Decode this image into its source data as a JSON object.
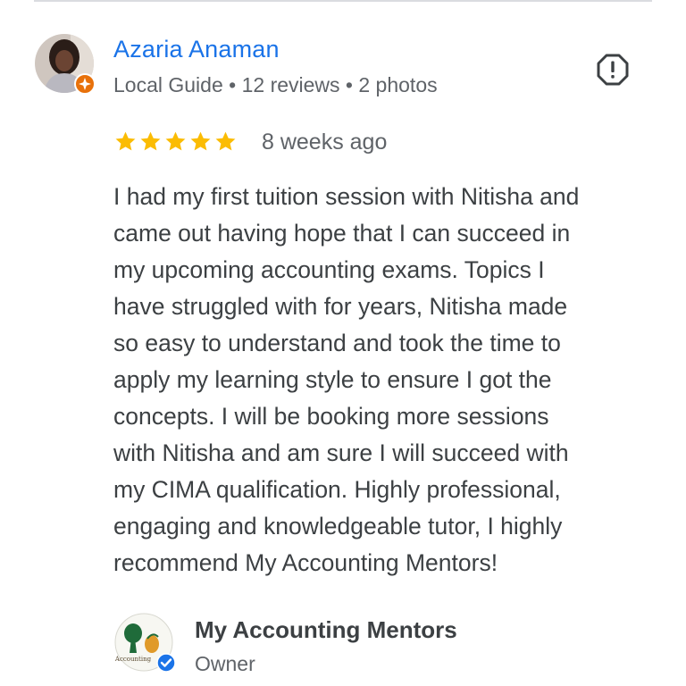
{
  "reviewer": {
    "name": "Azaria Anaman",
    "badge": "Local Guide",
    "reviews": "12 reviews",
    "photos": "2 photos",
    "separator": " • "
  },
  "review": {
    "rating": 5,
    "max_rating": 5,
    "date": "8 weeks ago",
    "text_lines": [
      "I had my first tuition session with Nitisha and",
      "came out having hope that I can succeed in",
      "my upcoming accounting exams. Topics I",
      "have struggled with for years, Nitisha made",
      "so easy to understand and took the time to",
      "apply my learning style to ensure I got the",
      "concepts. I will be booking more sessions",
      "with Nitisha and am sure I will succeed with",
      "my CIMA qualification. Highly professional,",
      "engaging and knowledgeable tutor, I highly",
      "recommend My Accounting Mentors!"
    ]
  },
  "owner": {
    "name": "My Accounting Mentors",
    "role": "Owner",
    "logo_text": "Accounting"
  },
  "icons": {
    "report": "report-icon",
    "star": "star-icon",
    "local_guide": "local-guide-badge-icon",
    "verified": "verified-check-icon"
  },
  "colors": {
    "name_link": "#1a73e8",
    "star": "#fbbc04",
    "guide_badge": "#e8710a",
    "verified": "#1a73e8",
    "text": "#3c4043",
    "muted": "#5f6368"
  }
}
